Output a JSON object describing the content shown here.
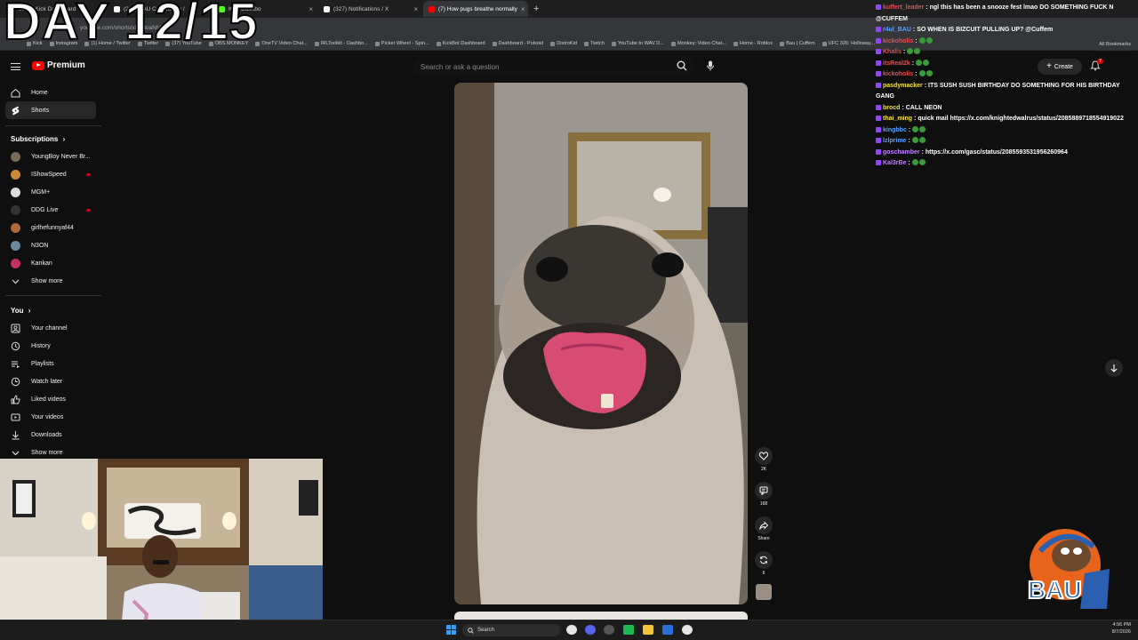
{
  "overlay": {
    "title": "DAY 12/15"
  },
  "browser": {
    "tabs": [
      {
        "label": "eam - Kick Dashboard",
        "active": false,
        "color": "#53fc18"
      },
      {
        "label": "(280) BAU Community /",
        "active": false,
        "color": "#ffffff"
      },
      {
        "label": "Kick Dashbo",
        "active": false,
        "color": "#53fc18"
      },
      {
        "label": "(327) Notifications / X",
        "active": false,
        "color": "#ffffff"
      },
      {
        "label": "(7) How pugs breathe normally",
        "active": true,
        "color": "#ff0000"
      }
    ],
    "url": "youtube.com/shorts/xLiMtoaNMA4",
    "bookmarks": [
      "Kick",
      "Instagram",
      "(1) Home / Twitter",
      "Twitter",
      "(37) YouTube",
      "OBS MONKEY",
      "OneTV Video Chat...",
      "IRLToolkit - Dashbo...",
      "Picker Wheel - Spin...",
      "KickBot Dashboard",
      "Dashboard - Pulsoid",
      "DistroKid",
      "Twitch",
      "YouTube to WAV D...",
      "Monkey: Video Chat...",
      "Home - Roblox",
      "Bau | Cuffem",
      "UFC 326: Holloway..."
    ],
    "all_bookmarks": "All Bookmarks"
  },
  "youtube": {
    "logo_text": "Premium",
    "search_placeholder": "Search or ask a question",
    "create_label": "Create",
    "notif_count": "7",
    "nav": {
      "home": "Home",
      "shorts": "Shorts"
    },
    "subscriptions_title": "Subscriptions",
    "subscriptions": [
      {
        "name": "YoungBoy Never Br...",
        "live": false,
        "color": "#7a6a5a"
      },
      {
        "name": "IShowSpeed",
        "live": true,
        "color": "#c98a3a"
      },
      {
        "name": "MGM+",
        "live": false,
        "color": "#dddddd"
      },
      {
        "name": "DDG Live",
        "live": true,
        "color": "#333333"
      },
      {
        "name": "girlhefunnyaf44",
        "live": false,
        "color": "#b06a3a"
      },
      {
        "name": "N3ON",
        "live": false,
        "color": "#6a8aa0"
      },
      {
        "name": "Kankan",
        "live": false,
        "color": "#c03060"
      }
    ],
    "show_more": "Show more",
    "you_title": "You",
    "you_items": [
      "Your channel",
      "History",
      "Playlists",
      "Watch later",
      "Liked videos",
      "Your videos",
      "Downloads"
    ],
    "show_more_2": "Show more",
    "actions": {
      "likes": "2K",
      "comments": "168",
      "share": "Share",
      "remix": "6"
    }
  },
  "chat": [
    {
      "user": "kuffert_leader",
      "text": "ngl this has been a snooze fest lmao DO SOMETHING FUCK N @CUFFEM",
      "color": "#e05050"
    },
    {
      "user": "r4ul_BAU",
      "text": "SO WHEN IS BIZCUIT PULLING UP? @Cuffem",
      "color": "#5aa0ff"
    },
    {
      "user": "kickoholis",
      "text": "",
      "color": "#e05050"
    },
    {
      "user": "Khalis",
      "text": "",
      "color": "#e05050"
    },
    {
      "user": "itsReal2k",
      "text": "",
      "color": "#e05050"
    },
    {
      "user": "kickoholis",
      "text": "",
      "color": "#e05050"
    },
    {
      "user": "pasdymacker",
      "text": "ITS SUSH SUSH BIRTHDAY DO SOMETHING FOR HIS BIRTHDAY GANG",
      "color": "#f0e040"
    },
    {
      "user": "brocd",
      "text": "CALL NEON",
      "color": "#f0e040"
    },
    {
      "user": "thai_ming",
      "text": "quick mail https://x.com/knightedwalrus/status/2085889718554919022",
      "color": "#f0e040"
    },
    {
      "user": "kingbbc",
      "text": "",
      "color": "#5aa0ff"
    },
    {
      "user": "lzlprime",
      "text": "",
      "color": "#5aa0ff"
    },
    {
      "user": "goschamber",
      "text": "https://x.com/gasc/status/2085593531956260964",
      "color": "#c080ff"
    },
    {
      "user": "Kal3rBe",
      "text": "",
      "color": "#c080ff"
    }
  ],
  "taskbar": {
    "search_label": "Search",
    "time": "4:56 PM",
    "date": "8/7/2026"
  }
}
